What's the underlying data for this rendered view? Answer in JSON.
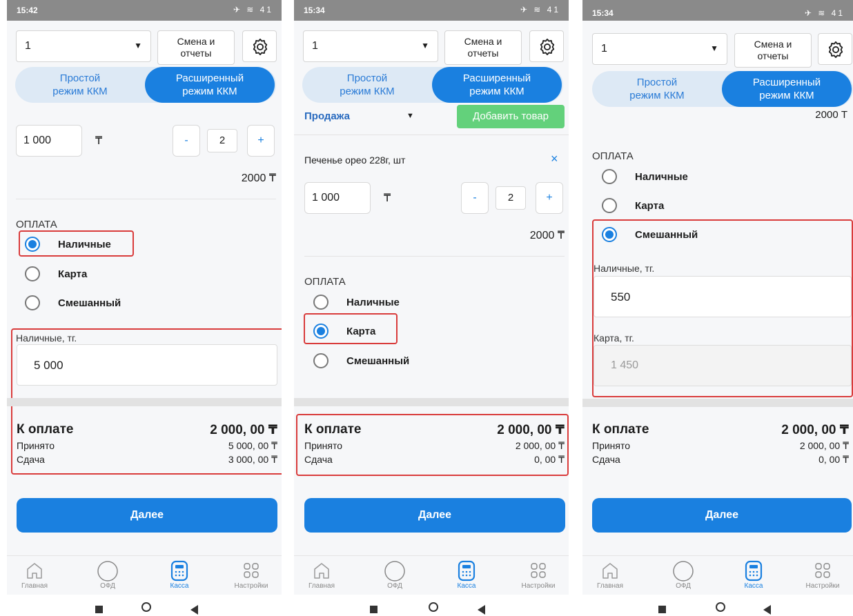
{
  "screens": [
    {
      "status_time": "15:42",
      "status_icons": "✈ ≋ 41",
      "kassa_value": "1",
      "shift_label": [
        "Смена и",
        "отчеты"
      ],
      "mode_simple": [
        "Простой",
        "режим ККМ"
      ],
      "mode_advanced": [
        "Расширенный",
        "режим ККМ"
      ],
      "price": "1 000",
      "currency": "₸",
      "qty_minus": "-",
      "qty": "2",
      "qty_plus": "+",
      "line_total": "2000 ₸",
      "payment_title": "ОПЛАТА",
      "payment_options": [
        "Наличные",
        "Карта",
        "Смешанный"
      ],
      "selected_payment": "Наличные",
      "cash_label": "Наличные, тг.",
      "cash_value": "5 000",
      "to_pay_label": "К оплате",
      "to_pay_value": "2 000, 00 ₸",
      "accepted_label": "Принято",
      "accepted_value": "5 000, 00 ₸",
      "change_label": "Сдача",
      "change_value": "3 000, 00 ₸",
      "next_button": "Далее"
    },
    {
      "status_time": "15:34",
      "status_icons": "✈ ≋ 41",
      "kassa_value": "1",
      "shift_label": [
        "Смена и",
        "отчеты"
      ],
      "mode_simple": [
        "Простой",
        "режим ККМ"
      ],
      "mode_advanced": [
        "Расширенный",
        "режим ККМ"
      ],
      "operation": "Продажа",
      "add_product_button": "Добавить товар",
      "product_name": "Печенье орео 228г, шт",
      "remove_icon": "×",
      "price": "1 000",
      "currency": "₸",
      "qty_minus": "-",
      "qty": "2",
      "qty_plus": "+",
      "line_total": "2000 ₸",
      "payment_title": "ОПЛАТА",
      "payment_options": [
        "Наличные",
        "Карта",
        "Смешанный"
      ],
      "selected_payment": "Карта",
      "to_pay_label": "К оплате",
      "to_pay_value": "2 000, 00 ₸",
      "accepted_label": "Принято",
      "accepted_value": "2 000, 00 ₸",
      "change_label": "Сдача",
      "change_value": "0, 00 ₸",
      "next_button": "Далее"
    },
    {
      "status_time": "15:34",
      "status_icons": "✈ ≋ 41",
      "kassa_value": "1",
      "shift_label": [
        "Смена и",
        "отчеты"
      ],
      "mode_simple": [
        "Простой",
        "режим ККМ"
      ],
      "mode_advanced": [
        "Расширенный",
        "режим ККМ"
      ],
      "partial_total": "2000 Т",
      "payment_title": "ОПЛАТА",
      "payment_options": [
        "Наличные",
        "Карта",
        "Смешанный"
      ],
      "selected_payment": "Смешанный",
      "cash_label": "Наличные, тг.",
      "cash_value": "550",
      "card_label": "Карта, тг.",
      "card_value": "1 450",
      "to_pay_label": "К оплате",
      "to_pay_value": "2 000, 00 ₸",
      "accepted_label": "Принято",
      "accepted_value": "2 000, 00 ₸",
      "change_label": "Сдача",
      "change_value": "0, 00 ₸",
      "next_button": "Далее"
    }
  ],
  "tabs": [
    "Главная",
    "ОФД",
    "Касса",
    "Настройки"
  ],
  "active_tab": "Касса",
  "colors": {
    "accent": "#1a80e0",
    "add_button": "#63d17b",
    "highlight": "#d93b3b"
  }
}
